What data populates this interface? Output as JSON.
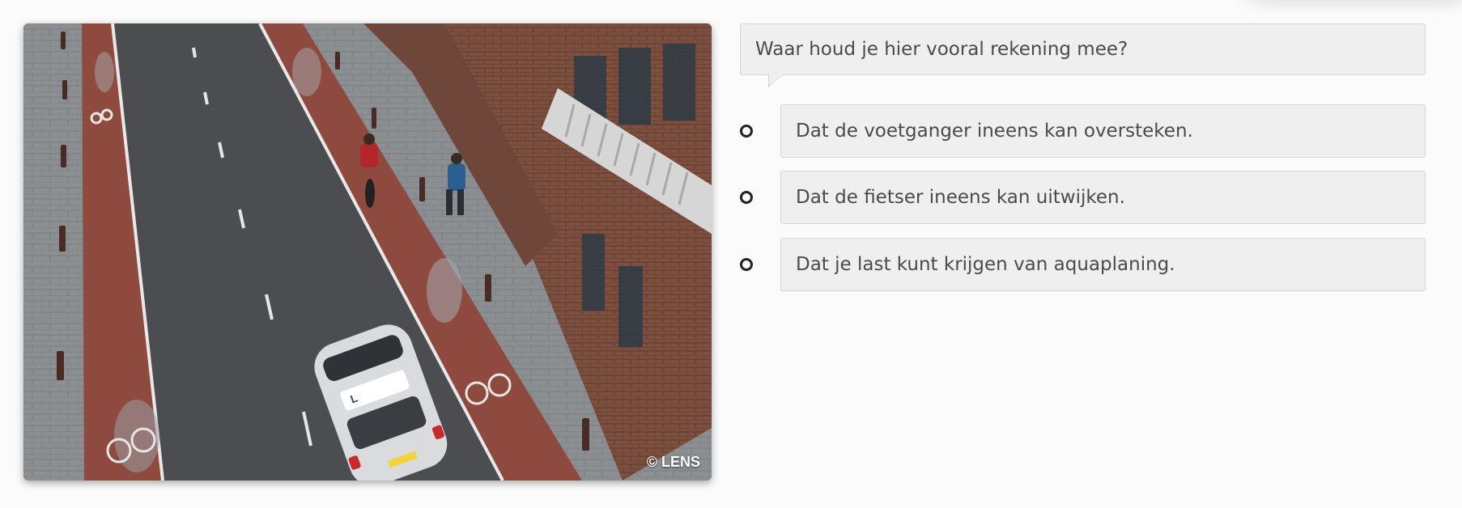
{
  "scene": {
    "watermark": "© LENS",
    "car_label": "L"
  },
  "question": {
    "text": "Waar houd je hier vooral rekening mee?"
  },
  "answers": [
    {
      "text": "Dat de voetganger ineens kan oversteken."
    },
    {
      "text": "Dat de fietser ineens kan uitwijken."
    },
    {
      "text": "Dat je last kunt krijgen van aquaplaning."
    }
  ]
}
